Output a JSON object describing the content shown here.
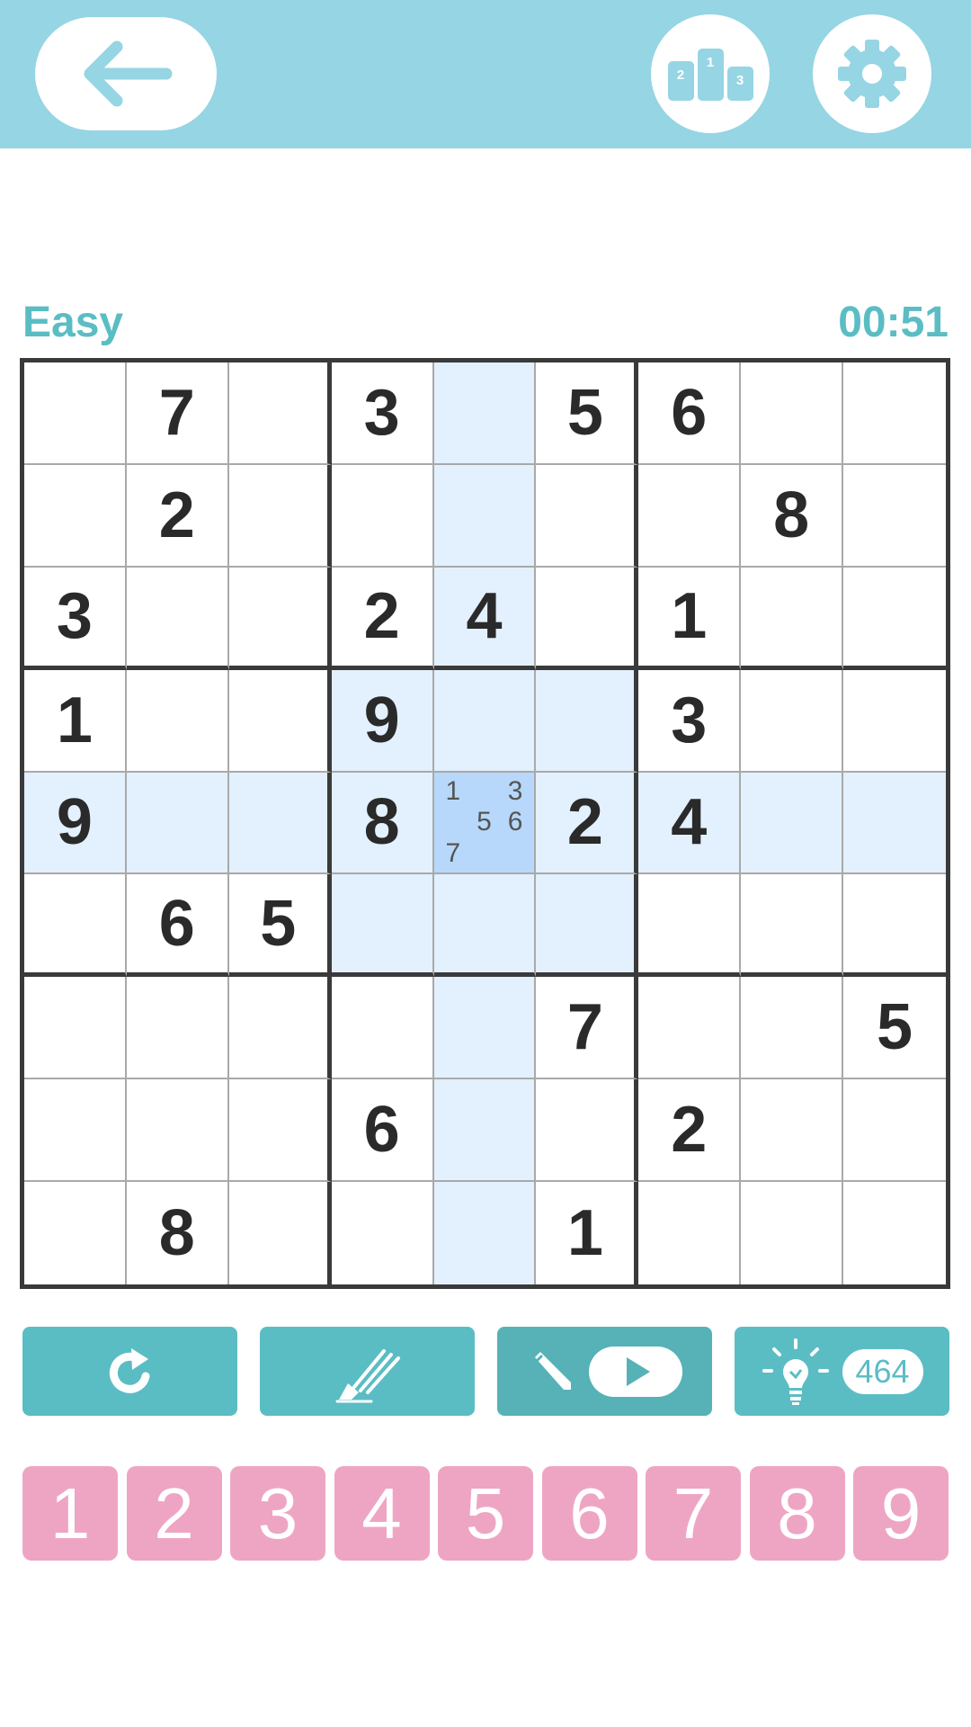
{
  "header": {
    "icons": {
      "back": "arrow-left-icon",
      "leaderboard": "podium-icon",
      "settings": "gear-icon"
    },
    "podium_labels": [
      "2",
      "1",
      "3"
    ]
  },
  "status": {
    "difficulty": "Easy",
    "timer": "00:51"
  },
  "board": {
    "givens": [
      [
        "",
        "7",
        "",
        "3",
        "",
        "5",
        "6",
        "",
        ""
      ],
      [
        "",
        "2",
        "",
        "",
        "",
        "",
        "",
        "8",
        ""
      ],
      [
        "3",
        "",
        "",
        "2",
        "4",
        "",
        "1",
        "",
        ""
      ],
      [
        "1",
        "",
        "",
        "9",
        "",
        "",
        "3",
        "",
        ""
      ],
      [
        "9",
        "",
        "",
        "8",
        "",
        "2",
        "4",
        "",
        ""
      ],
      [
        "",
        "6",
        "5",
        "",
        "",
        "",
        "",
        "",
        ""
      ],
      [
        "",
        "",
        "",
        "",
        "",
        "7",
        "",
        "",
        "5"
      ],
      [
        "",
        "",
        "",
        "6",
        "",
        "",
        "2",
        "",
        ""
      ],
      [
        "",
        "8",
        "",
        "",
        "",
        "1",
        "",
        "",
        ""
      ]
    ],
    "selected": {
      "row": 5,
      "col": 5
    },
    "notes": {
      "r5c5": [
        "1",
        "",
        "3",
        "",
        "5",
        "6",
        "7",
        "",
        ""
      ]
    }
  },
  "tools": {
    "undo": {
      "icon": "undo-icon"
    },
    "erase": {
      "icon": "eraser-icon"
    },
    "notes": {
      "icon": "pencil-icon",
      "badge_icon": "play-icon"
    },
    "hint": {
      "icon": "lightbulb-icon",
      "count": "464"
    }
  },
  "numpad": [
    "1",
    "2",
    "3",
    "4",
    "5",
    "6",
    "7",
    "8",
    "9"
  ],
  "colors": {
    "header_bg": "#96d5e3",
    "accent": "#5bbdc4",
    "numpad_bg": "#eea5c3",
    "highlight": "#e3f0fd",
    "selected_cell": "#b7d8fa"
  }
}
